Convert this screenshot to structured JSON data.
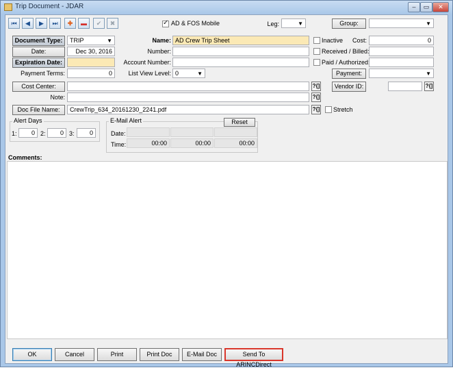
{
  "window": {
    "title": "Trip Document - JDAR",
    "minimize_label": "–",
    "restore_label": "▭",
    "close_label": "✕"
  },
  "toolbar": {
    "first_icon": "first-record-icon",
    "prev_icon": "previous-record-icon",
    "next_icon": "next-record-icon",
    "last_icon": "last-record-icon",
    "add_icon": "add-icon",
    "delete_icon": "delete-icon",
    "save_icon": "check-icon",
    "cancel_icon": "cancel-icon",
    "ad_fos_label": "AD & FOS Mobile",
    "ad_fos_checked": true,
    "leg_label": "Leg:",
    "leg_value": "",
    "group_button": "Group:",
    "group_value": ""
  },
  "form": {
    "document_type_button": "Document Type:",
    "document_type_value": "TRIP",
    "date_button": "Date:",
    "date_value": "Dec 30, 2016",
    "expiration_date_button": "Expiration Date:",
    "expiration_date_value": "",
    "payment_terms_label": "Payment Terms:",
    "payment_terms_value": "0",
    "name_label": "Name:",
    "name_value": "AD Crew Trip Sheet",
    "number_label": "Number:",
    "number_value": "",
    "account_number_label": "Account Number:",
    "account_number_value": "",
    "list_view_level_label": "List View Level:",
    "list_view_level_value": "0",
    "inactive_label": "Inactive",
    "inactive_checked": false,
    "cost_label": "Cost:",
    "cost_value": "0",
    "received_billed_label": "Received / Billed:",
    "received_billed_checked": false,
    "received_billed_value": "",
    "paid_authorized_label": "Paid / Authorized:",
    "paid_authorized_checked": false,
    "paid_authorized_value": "",
    "payment_button": "Payment:",
    "payment_value": "",
    "cost_center_button": "Cost Center:",
    "cost_center_value": "",
    "vendor_id_button": "Vendor ID:",
    "vendor_id_value": "",
    "note_label": "Note:",
    "note_value": "",
    "doc_file_name_button": "Doc File Name:",
    "doc_file_name_value": "CrewTrip_634_20161230_2241.pdf",
    "stretch_label": "Stretch",
    "stretch_checked": false,
    "lookup_label": "?{]"
  },
  "alert_days": {
    "title": "Alert Days",
    "label_1": "1:",
    "value_1": "0",
    "label_2": "2:",
    "value_2": "0",
    "label_3": "3:",
    "value_3": "0"
  },
  "email_alert": {
    "title": "E-Mail Alert",
    "reset_button": "Reset",
    "date_label": "Date:",
    "time_label": "Time:",
    "dates": [
      "",
      "",
      ""
    ],
    "times": [
      "00:00",
      "00:00",
      "00:00"
    ]
  },
  "comments": {
    "label": "Comments:",
    "value": ""
  },
  "buttons": {
    "ok": "OK",
    "cancel": "Cancel",
    "print": "Print",
    "print_doc": "Print Doc",
    "email_doc": "E-Mail Doc",
    "send_arinc": "Send To ARINCDirect"
  },
  "colors": {
    "highlight_border": "#d9362b",
    "yellow_field": "#fbe9b5"
  }
}
